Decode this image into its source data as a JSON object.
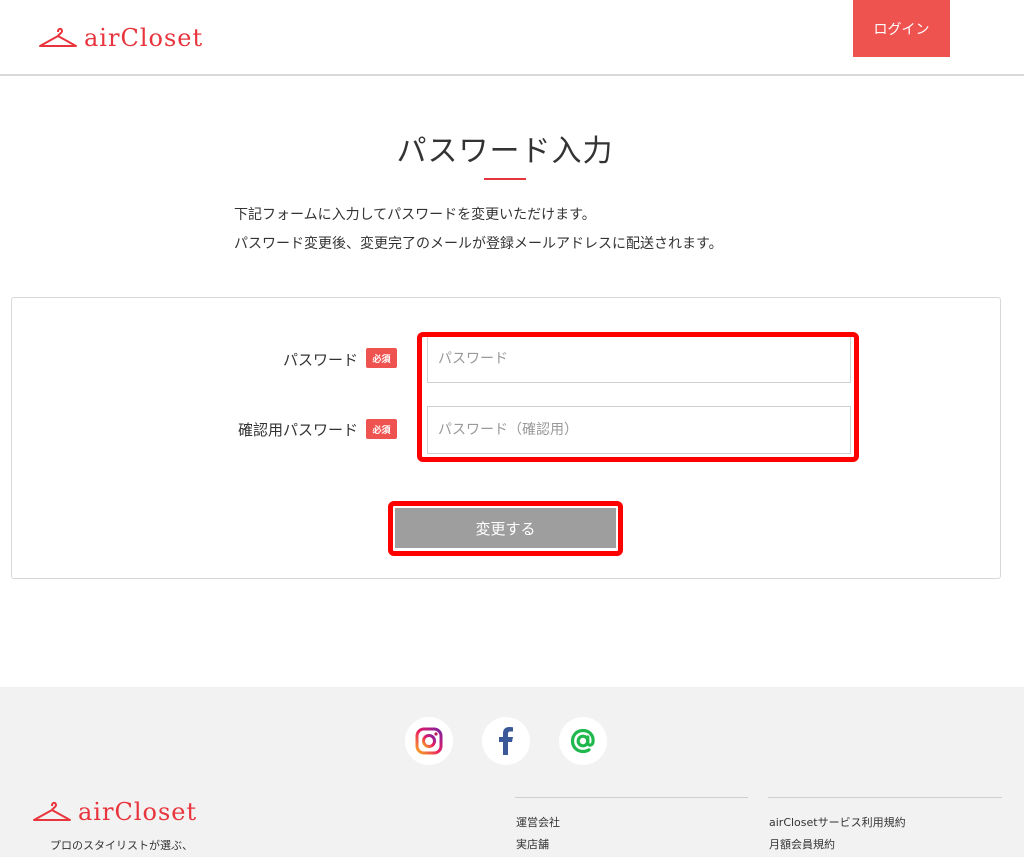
{
  "header": {
    "brand": "airCloset",
    "login_label": "ログイン"
  },
  "main": {
    "title": "パスワード入力",
    "description": [
      "下記フォームに入力してパスワードを変更いただけます。",
      "パスワード変更後、変更完了のメールが登録メールアドレスに配送されます。"
    ]
  },
  "form": {
    "password_label": "パスワード",
    "password_placeholder": "パスワード",
    "password_value": "",
    "confirm_label": "確認用パスワード",
    "confirm_placeholder": "パスワード（確認用）",
    "confirm_value": "",
    "required_badge": "必須",
    "submit_label": "変更する"
  },
  "footer": {
    "brand": "airCloset",
    "tagline": "プロのスタイリストが選ぶ、",
    "social": [
      "instagram-icon",
      "facebook-icon",
      "line-at-icon"
    ],
    "links_col1": [
      "運営会社",
      "実店舗"
    ],
    "links_col2": [
      "airClosetサービス利用規約",
      "月額会員規約"
    ]
  },
  "colors": {
    "brand_red": "#e8343c",
    "login_bg": "#ef5350",
    "highlight": "#ff0000",
    "submit_bg": "#9e9e9e"
  }
}
